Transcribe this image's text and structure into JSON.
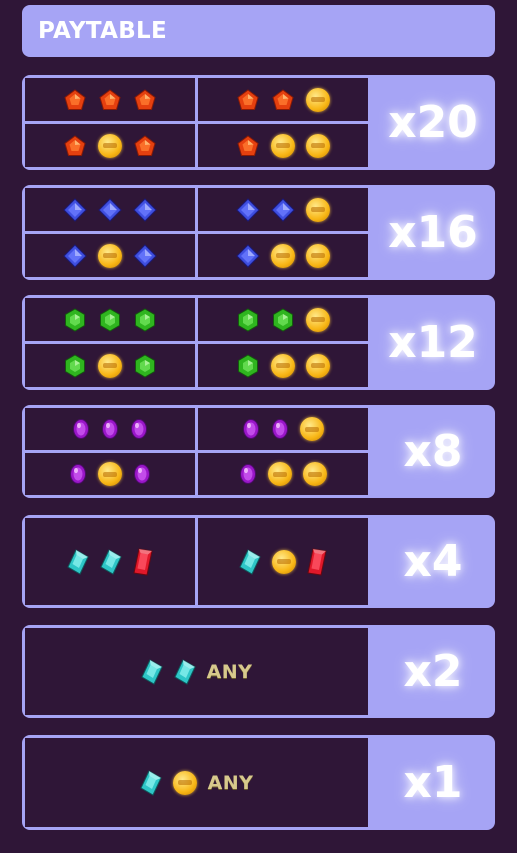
{
  "header": {
    "title": "PAYTABLE"
  },
  "symbols": {
    "red": {
      "icon": "red-pentagon-gem-icon",
      "color": "#e5400f"
    },
    "blue": {
      "icon": "blue-diamond-gem-icon",
      "color": "#3f4fe0"
    },
    "green": {
      "icon": "green-hexagon-gem-icon",
      "color": "#2fb51f"
    },
    "purple": {
      "icon": "purple-oval-gem-icon",
      "color": "#9a17c9"
    },
    "cyan": {
      "icon": "cyan-crystal-gem-icon",
      "color": "#2ec6c7"
    },
    "ruby": {
      "icon": "red-ruby-gem-icon",
      "color": "#e0182a"
    },
    "coin": {
      "icon": "gold-coin-icon",
      "color": "#f8b615"
    }
  },
  "rows": [
    {
      "multiplier": "x20",
      "combos": [
        [
          "red",
          "red",
          "red"
        ],
        [
          "red",
          "red",
          "coin"
        ],
        [
          "red",
          "coin",
          "red"
        ],
        [
          "red",
          "coin",
          "coin"
        ]
      ]
    },
    {
      "multiplier": "x16",
      "combos": [
        [
          "blue",
          "blue",
          "blue"
        ],
        [
          "blue",
          "blue",
          "coin"
        ],
        [
          "blue",
          "coin",
          "blue"
        ],
        [
          "blue",
          "coin",
          "coin"
        ]
      ]
    },
    {
      "multiplier": "x12",
      "combos": [
        [
          "green",
          "green",
          "green"
        ],
        [
          "green",
          "green",
          "coin"
        ],
        [
          "green",
          "coin",
          "green"
        ],
        [
          "green",
          "coin",
          "coin"
        ]
      ]
    },
    {
      "multiplier": "x8",
      "combos": [
        [
          "purple",
          "purple",
          "purple"
        ],
        [
          "purple",
          "purple",
          "coin"
        ],
        [
          "purple",
          "coin",
          "purple"
        ],
        [
          "purple",
          "coin",
          "coin"
        ]
      ]
    },
    {
      "multiplier": "x4",
      "combos": [
        [
          "cyan",
          "cyan",
          "ruby"
        ],
        [
          "cyan",
          "coin",
          "ruby"
        ]
      ]
    },
    {
      "multiplier": "x2",
      "combos": [
        [
          "cyan",
          "cyan",
          "any"
        ]
      ]
    },
    {
      "multiplier": "x1",
      "combos": [
        [
          "cyan",
          "coin",
          "any"
        ]
      ]
    }
  ],
  "any_label": "ANY"
}
